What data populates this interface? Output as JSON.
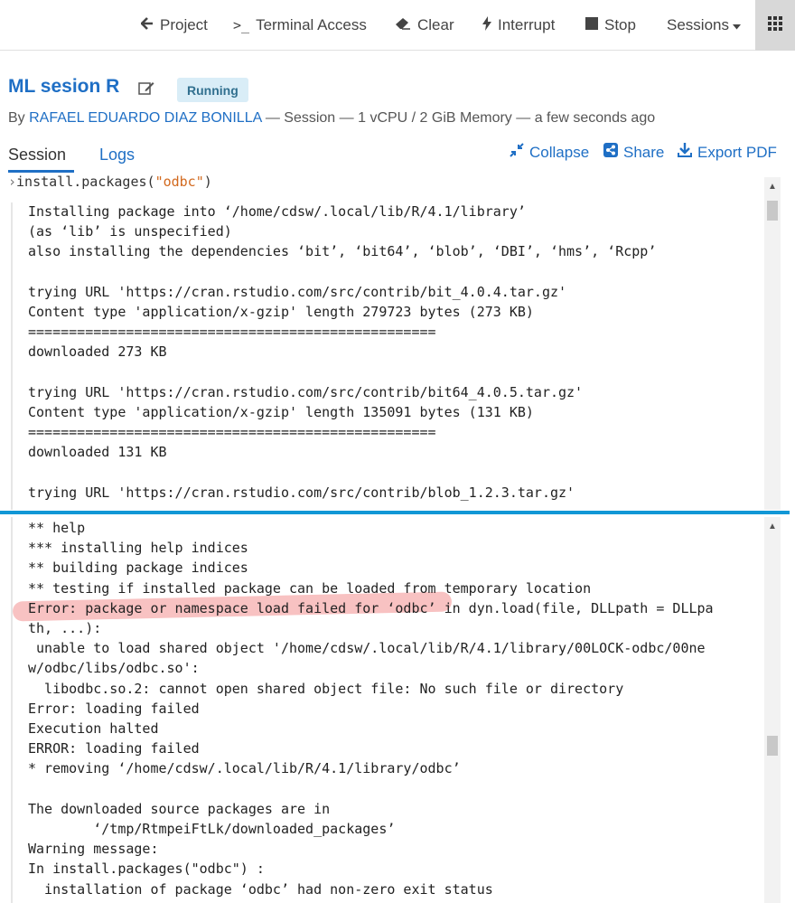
{
  "toolbar": {
    "project": "Project",
    "terminal": "Terminal Access",
    "clear": "Clear",
    "interrupt": "Interrupt",
    "stop": "Stop",
    "sessions": "Sessions"
  },
  "session": {
    "title": "ML sesion R",
    "status": "Running",
    "by": "By",
    "author": "RAFAEL EDUARDO DIAZ BONILLA",
    "meta": " — Session — 1 vCPU / 2 GiB Memory — a few seconds ago"
  },
  "tabs": {
    "session": "Session",
    "logs": "Logs"
  },
  "actions": {
    "collapse": "Collapse",
    "share": "Share",
    "export": "Export PDF"
  },
  "console": {
    "prompt_cmd": "install.packages(",
    "prompt_arg": "\"odbc\"",
    "prompt_close": ")",
    "output_top": "Installing package into ‘/home/cdsw/.local/lib/R/4.1/library’\n(as ‘lib’ is unspecified)\nalso installing the dependencies ‘bit’, ‘bit64’, ‘blob’, ‘DBI’, ‘hms’, ‘Rcpp’\n\ntrying URL 'https://cran.rstudio.com/src/contrib/bit_4.0.4.tar.gz'\nContent type 'application/x-gzip' length 279723 bytes (273 KB)\n==================================================\ndownloaded 273 KB\n\ntrying URL 'https://cran.rstudio.com/src/contrib/bit64_4.0.5.tar.gz'\nContent type 'application/x-gzip' length 135091 bytes (131 KB)\n==================================================\ndownloaded 131 KB\n\ntrying URL 'https://cran.rstudio.com/src/contrib/blob_1.2.3.tar.gz'",
    "output_bottom": "** help\n*** installing help indices\n** building package indices\n** testing if installed package can be loaded from temporary location\nError: package or namespace load failed for ‘odbc’ in dyn.load(file, DLLpath = DLLpa\nth, ...):\n unable to load shared object '/home/cdsw/.local/lib/R/4.1/library/00LOCK-odbc/00ne\nw/odbc/libs/odbc.so':\n  libodbc.so.2: cannot open shared object file: No such file or directory\nError: loading failed\nExecution halted\nERROR: loading failed\n* removing ‘/home/cdsw/.local/lib/R/4.1/library/odbc’\n\nThe downloaded source packages are in\n        ‘/tmp/RtmpeiFtLk/downloaded_packages’\nWarning message:\nIn install.packages(\"odbc\") :\n  installation of package ‘odbc’ had non-zero exit status"
  },
  "icons": {
    "project": "arrow-left-icon",
    "terminal": "terminal-icon",
    "clear": "eraser-icon",
    "interrupt": "bolt-icon",
    "stop": "stop-icon",
    "apps": "grid-icon",
    "edit": "edit-icon",
    "collapse": "compress-icon",
    "share": "share-icon",
    "export": "download-icon"
  },
  "colors": {
    "link": "#1f6fc5",
    "badge_bg": "#d9edf7",
    "divider": "#1197d6",
    "highlight": "#f07878"
  }
}
